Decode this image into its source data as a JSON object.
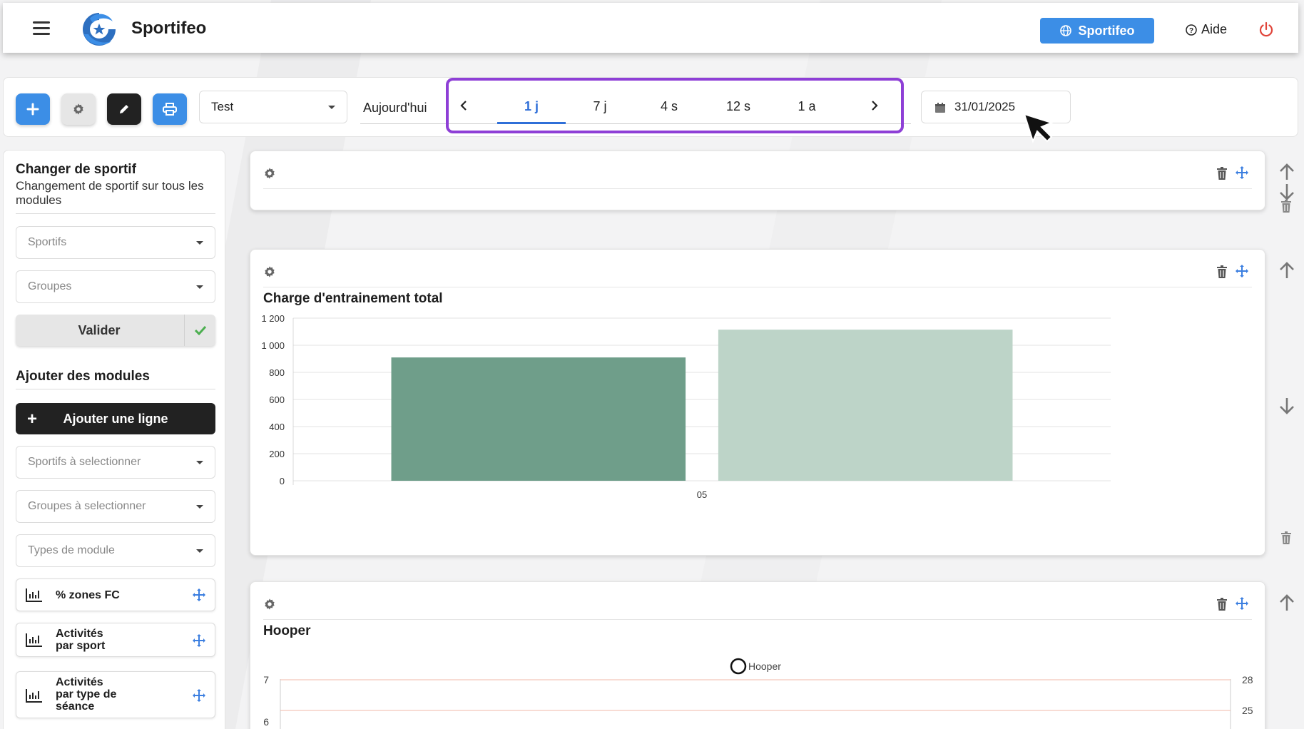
{
  "header": {
    "app_name": "Sportifeo",
    "brand_button": "Sportifeo",
    "help_label": "Aide"
  },
  "toolbar": {
    "selected_view": "Test",
    "today_label": "Aujourd'hui",
    "periods": [
      "1 j",
      "7 j",
      "4 s",
      "12 s",
      "1 a"
    ],
    "active_period": "1 j",
    "date_value": "31/01/2025"
  },
  "sidebar": {
    "change_title": "Changer de sportif",
    "change_subtitle": "Changement de sportif sur tous les modules",
    "athletes_placeholder": "Sportifs",
    "groups_placeholder": "Groupes",
    "validate_label": "Valider",
    "add_modules_title": "Ajouter des modules",
    "add_line_label": "Ajouter une ligne",
    "athletes_select_placeholder": "Sportifs à selectionner",
    "groups_select_placeholder": "Groupes à selectionner",
    "module_types_placeholder": "Types de module",
    "modules": [
      {
        "label_lines": [
          "% zones FC"
        ]
      },
      {
        "label_lines": [
          "Activités",
          "par sport"
        ]
      },
      {
        "label_lines": [
          "Activités",
          "par type de",
          "séance"
        ]
      }
    ]
  },
  "panels": {
    "charge_title": "Charge d'entrainement total",
    "hooper_title": "Hooper"
  },
  "colors": {
    "accent": "#3c8ee6",
    "highlight_border": "#8e3fd6",
    "bar_dark": "#6f9e8a",
    "bar_light": "#bdd4c8"
  },
  "chart_data": [
    {
      "type": "bar",
      "title": "Charge d'entrainement total",
      "categories": [
        "05"
      ],
      "series": [
        {
          "values": [
            910
          ],
          "color": "#6f9e8a"
        },
        {
          "values": [
            1115
          ],
          "color": "#bdd4c8"
        }
      ],
      "y_ticks": [
        "0",
        "200",
        "400",
        "600",
        "800",
        "1 000",
        "1 200"
      ],
      "ylim": [
        0,
        1200
      ],
      "grid": true
    },
    {
      "type": "line",
      "title": "Hooper",
      "legend": [
        "Hooper"
      ],
      "legend_placement": "top-center",
      "y_left_ticks": [
        "6",
        "7"
      ],
      "y_right_ticks": [
        "25",
        "28"
      ]
    }
  ]
}
